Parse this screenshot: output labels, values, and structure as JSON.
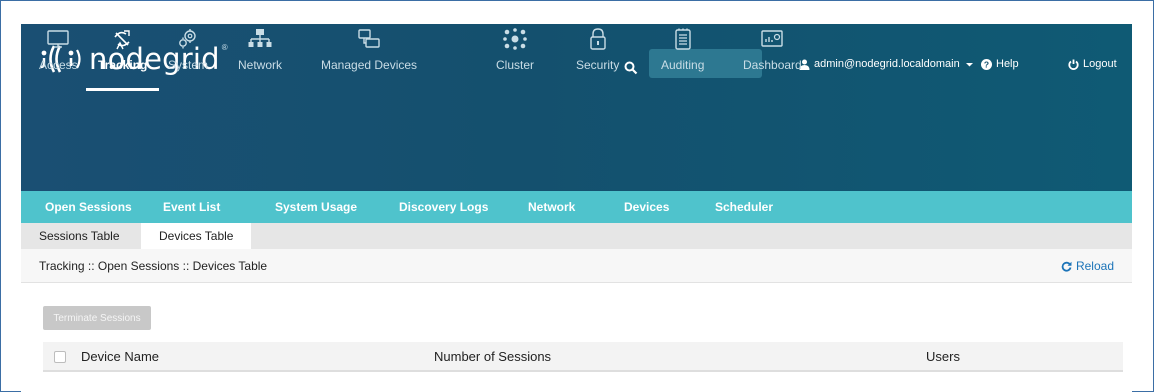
{
  "brand": {
    "name": "nodegrid",
    "reg": "®"
  },
  "header": {
    "search_placeholder": "",
    "user": "admin@nodegrid.localdomain",
    "help": "Help",
    "logout": "Logout"
  },
  "nav": {
    "items": [
      {
        "label": "Access",
        "icon": "monitor-icon"
      },
      {
        "label": "Tracking",
        "icon": "satellite-icon",
        "active": true
      },
      {
        "label": "System",
        "icon": "gears-icon"
      },
      {
        "label": "Network",
        "icon": "network-icon"
      },
      {
        "label": "Managed Devices",
        "icon": "devices-icon"
      },
      {
        "label": "Cluster",
        "icon": "cluster-icon"
      },
      {
        "label": "Security",
        "icon": "lock-icon"
      },
      {
        "label": "Auditing",
        "icon": "clipboard-icon"
      },
      {
        "label": "Dashboard",
        "icon": "dashboard-icon"
      }
    ]
  },
  "subnav": {
    "items": [
      "Open Sessions",
      "Event List",
      "System Usage",
      "Discovery Logs",
      "Network",
      "Devices",
      "Scheduler"
    ]
  },
  "tabs": {
    "items": [
      "Sessions Table",
      "Devices Table"
    ],
    "active": "Devices Table"
  },
  "breadcrumb": "Tracking :: Open Sessions :: Devices Table",
  "reload": "Reload",
  "actions": {
    "terminate": "Terminate Sessions"
  },
  "table": {
    "columns": [
      "Device Name",
      "Number of Sessions",
      "Users"
    ]
  },
  "colors": {
    "header": "#14506e",
    "subnav": "#4fc3cc",
    "link": "#1c74b8"
  }
}
